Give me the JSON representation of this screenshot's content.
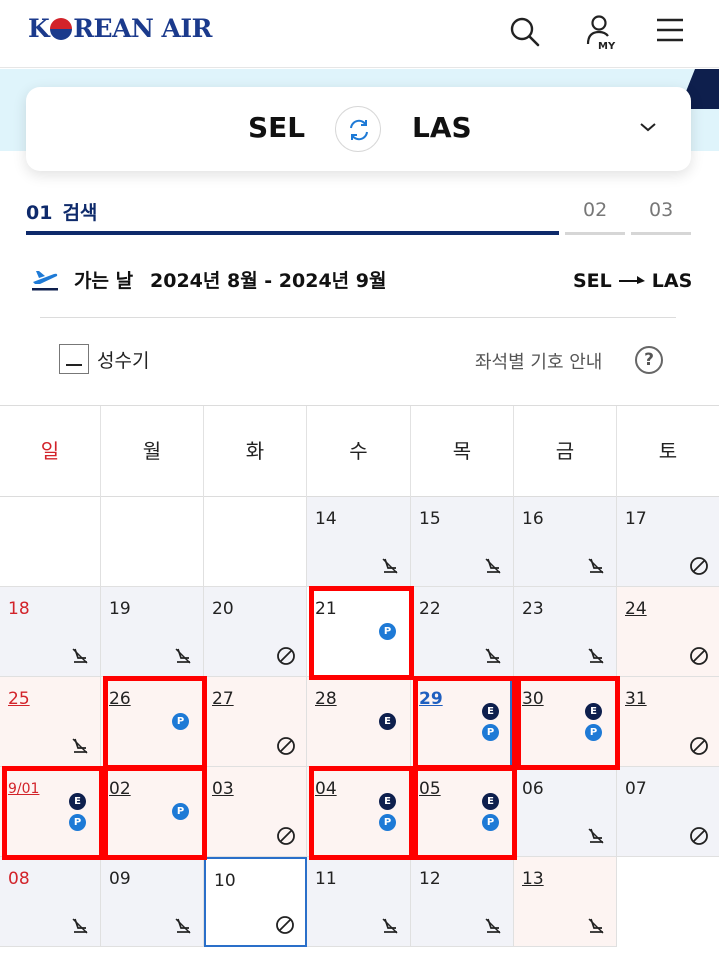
{
  "header": {
    "logo_text_1": "K",
    "logo_text_2": "REAN AIR",
    "icons": [
      "search-icon",
      "my-account-icon",
      "menu-icon"
    ],
    "my_label": "MY"
  },
  "route": {
    "from": "SEL",
    "to": "LAS",
    "swap_icon": "swap-icon",
    "expand_icon": "chevron-down-icon"
  },
  "steps": {
    "step1_num": "01",
    "step1_label": "검색",
    "step2": "02",
    "step3": "03"
  },
  "departure": {
    "label": "가는 날",
    "range": "2024년 8월 - 2024년 9월",
    "from": "SEL",
    "to": "LAS"
  },
  "legend": {
    "peak_label": "성수기",
    "seat_guide": "좌석별 기호 안내",
    "help": "?"
  },
  "calendar": {
    "weekdays": [
      "일",
      "월",
      "화",
      "수",
      "목",
      "금",
      "토"
    ],
    "weeks": [
      [
        null,
        null,
        null,
        {
          "day": "14",
          "bg": "gray",
          "symbol": "no-seat"
        },
        {
          "day": "15",
          "bg": "gray",
          "symbol": "no-seat"
        },
        {
          "day": "16",
          "bg": "gray",
          "symbol": "no-seat"
        },
        {
          "day": "17",
          "bg": "gray",
          "symbol": "unavailable"
        }
      ],
      [
        {
          "day": "18",
          "bg": "gray",
          "red": true,
          "symbol": "no-seat"
        },
        {
          "day": "19",
          "bg": "gray",
          "symbol": "no-seat"
        },
        {
          "day": "20",
          "bg": "gray",
          "symbol": "unavailable"
        },
        {
          "day": "21",
          "bg": "white",
          "badges": [
            "P"
          ]
        },
        {
          "day": "22",
          "bg": "gray",
          "symbol": "no-seat"
        },
        {
          "day": "23",
          "bg": "gray",
          "symbol": "no-seat"
        },
        {
          "day": "24",
          "bg": "pink",
          "underline": true,
          "symbol": "unavailable"
        }
      ],
      [
        {
          "day": "25",
          "bg": "pink",
          "red": true,
          "underline": true,
          "symbol": "no-seat"
        },
        {
          "day": "26",
          "bg": "pink",
          "underline": true,
          "badges": [
            "P"
          ]
        },
        {
          "day": "27",
          "bg": "pink",
          "underline": true,
          "symbol": "unavailable"
        },
        {
          "day": "28",
          "bg": "pink",
          "underline": true,
          "badges": [
            "E"
          ]
        },
        {
          "day": "29",
          "bg": "pink",
          "underline": true,
          "blue": true,
          "badges": [
            "E",
            "P"
          ]
        },
        {
          "day": "30",
          "bg": "pink",
          "underline": true,
          "badges": [
            "E",
            "P"
          ]
        },
        {
          "day": "31",
          "bg": "pink",
          "underline": true,
          "symbol": "unavailable"
        }
      ],
      [
        {
          "day": "9/01",
          "bg": "pink",
          "red": true,
          "underline": true,
          "small": true,
          "badges": [
            "E",
            "P"
          ]
        },
        {
          "day": "02",
          "bg": "pink",
          "underline": true,
          "badges": [
            "P"
          ]
        },
        {
          "day": "03",
          "bg": "pink",
          "underline": true,
          "symbol": "unavailable"
        },
        {
          "day": "04",
          "bg": "pink",
          "underline": true,
          "badges": [
            "E",
            "P"
          ]
        },
        {
          "day": "05",
          "bg": "pink",
          "underline": true,
          "badges": [
            "E",
            "P"
          ]
        },
        {
          "day": "06",
          "bg": "gray",
          "symbol": "no-seat"
        },
        {
          "day": "07",
          "bg": "gray",
          "symbol": "unavailable"
        }
      ],
      [
        {
          "day": "08",
          "bg": "gray",
          "red": true,
          "symbol": "no-seat"
        },
        {
          "day": "09",
          "bg": "gray",
          "symbol": "no-seat"
        },
        {
          "day": "10",
          "bg": "white",
          "selected": true,
          "symbol": "unavailable"
        },
        {
          "day": "11",
          "bg": "gray",
          "symbol": "no-seat"
        },
        {
          "day": "12",
          "bg": "gray",
          "symbol": "no-seat"
        },
        {
          "day": "13",
          "bg": "pink",
          "underline": true,
          "symbol": "no-seat"
        },
        null
      ]
    ],
    "highlighted_days": [
      "21",
      "26",
      "29",
      "30",
      "9/01",
      "02",
      "04",
      "05"
    ]
  },
  "colors": {
    "navy": "#0e2a6b",
    "badge_e": "#0e1f4d",
    "badge_p": "#1e7ad6",
    "sunday_red": "#d2232a",
    "highlight": "#ff0000",
    "peak_pink": "#fdf4f2",
    "gray_cell": "#f2f3f8"
  }
}
